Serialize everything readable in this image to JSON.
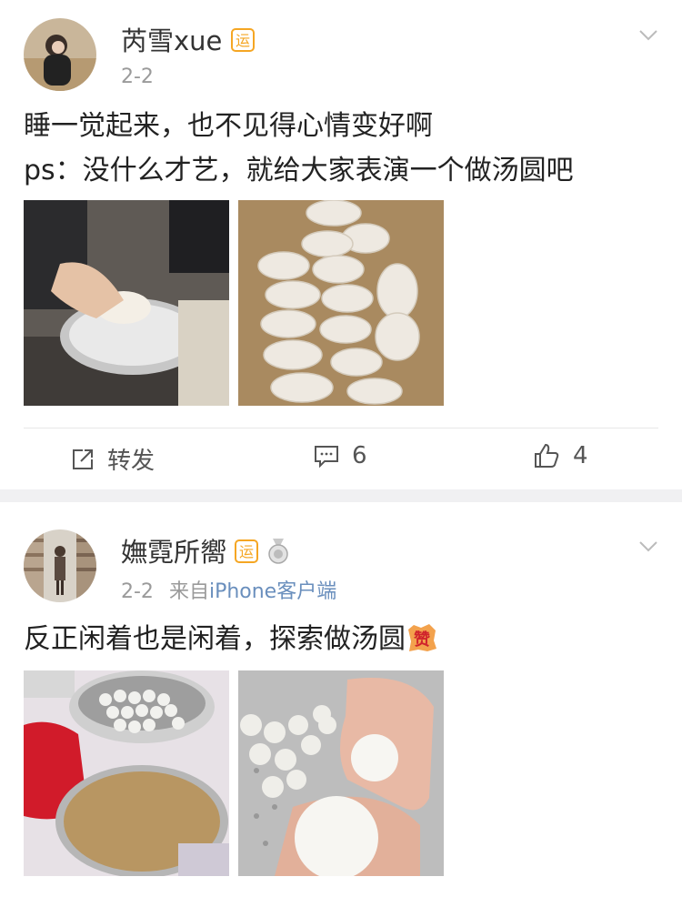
{
  "posts": [
    {
      "author": "芮雪xue",
      "date": "2-2",
      "text_line1": "睡一觉起来，也不见得心情变好啊",
      "text_line2": "ps：没什么才艺，就给大家表演一个做汤圆吧",
      "badge_char": "运",
      "actions": {
        "repost_label": "转发",
        "comment_count": "6",
        "like_count": "4"
      }
    },
    {
      "author": "嫵霓所嚮",
      "date": "2-2",
      "source_prefix": "来自",
      "source": "iPhone客户端",
      "text_line1": "反正闲着也是闲着，探索做汤圆",
      "badge_char": "运",
      "emoji_char": "赞"
    }
  ],
  "colors": {
    "badge": "#f5a623",
    "source_link": "#6a8fbd",
    "separator": "#f0f0f2"
  }
}
